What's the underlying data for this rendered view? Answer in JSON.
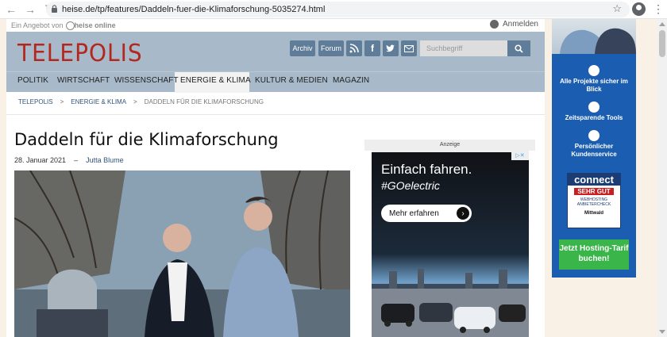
{
  "browser": {
    "url": "heise.de/tp/features/Daddeln-fuer-die-Klimaforschung-5035274.html"
  },
  "top": {
    "offer": "Ein Angebot von",
    "heise": "heise online",
    "login": "Anmelden"
  },
  "header": {
    "logo": "TELEPOLIS",
    "archiv": "Archiv",
    "forum": "Forum",
    "search_placeholder": "Suchbegriff"
  },
  "nav": {
    "items": [
      "POLITIK",
      "WIRTSCHAFT",
      "WISSENSCHAFT",
      "ENERGIE & KLIMA",
      "KULTUR & MEDIEN",
      "MAGAZIN"
    ]
  },
  "breadcrumb": [
    "TELEPOLIS",
    ">",
    "ENERGIE & KLIMA",
    ">",
    "DADDELN FÜR DIE KLIMAFORSCHUNG"
  ],
  "article": {
    "title": "Daddeln für die Klimaforschung",
    "date": "28. Januar 2021",
    "dash": "–",
    "author": "Jutta Blume"
  },
  "ad": {
    "label": "Anzeige",
    "title": "Einfach fahren.",
    "subtitle": "#GOelectric",
    "button": "Mehr erfahren"
  },
  "sidebar": {
    "item1": "Alle Projekte sicher im Blick",
    "item2": "Zeitsparende Tools",
    "item3": "Persönlicher Kundenservice",
    "badge1": "connect",
    "badge2": "SEHR GUT",
    "badge3": "WEBHOSTING ANBIETERCHECK",
    "badge4": "Mittwald",
    "cta": "Jetzt Hosting-Tarif buchen!"
  }
}
